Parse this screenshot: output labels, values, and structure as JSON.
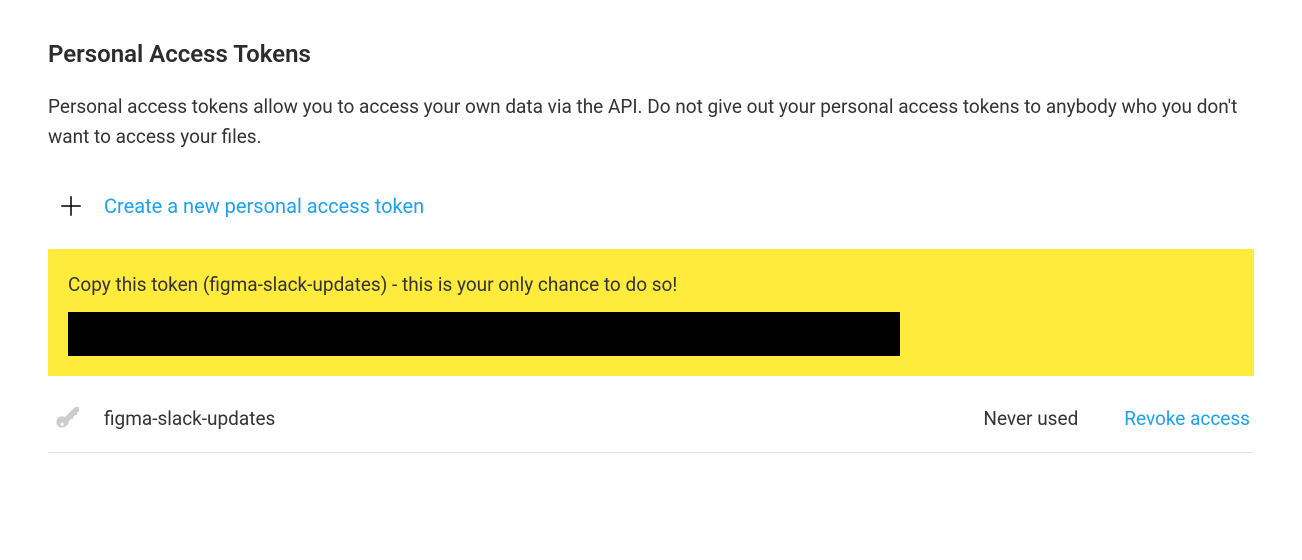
{
  "section": {
    "title": "Personal Access Tokens",
    "description": "Personal access tokens allow you to access your own data via the API. Do not give out your personal access tokens to anybody who you don't want to access your files."
  },
  "create": {
    "link_text": "Create a new personal access token"
  },
  "notice": {
    "message": "Copy this token (figma-slack-updates) - this is your only chance to do so!"
  },
  "tokens": [
    {
      "name": "figma-slack-updates",
      "usage": "Never used",
      "revoke_label": "Revoke access"
    }
  ],
  "colors": {
    "link": "#1da1f2",
    "highlight": "#ffeb3b"
  }
}
